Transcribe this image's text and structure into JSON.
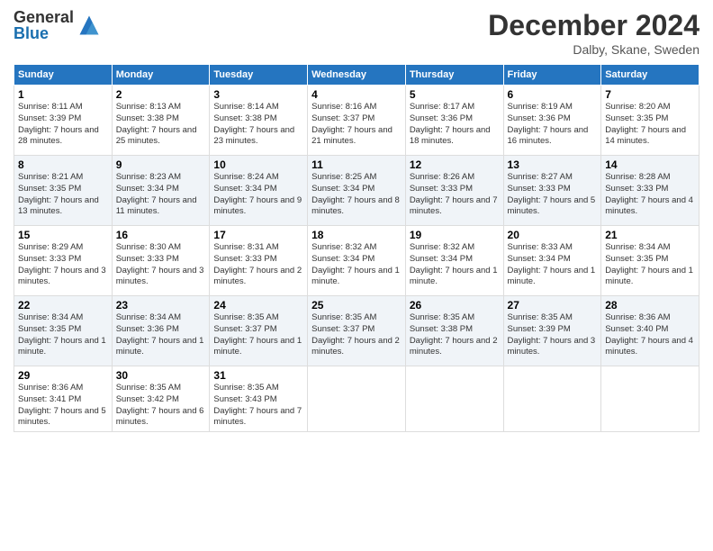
{
  "header": {
    "logo_general": "General",
    "logo_blue": "Blue",
    "month_title": "December 2024",
    "location": "Dalby, Skane, Sweden"
  },
  "days_of_week": [
    "Sunday",
    "Monday",
    "Tuesday",
    "Wednesday",
    "Thursday",
    "Friday",
    "Saturday"
  ],
  "weeks": [
    [
      {
        "day": "1",
        "sunrise": "8:11 AM",
        "sunset": "3:39 PM",
        "daylight": "7 hours and 28 minutes."
      },
      {
        "day": "2",
        "sunrise": "8:13 AM",
        "sunset": "3:38 PM",
        "daylight": "7 hours and 25 minutes."
      },
      {
        "day": "3",
        "sunrise": "8:14 AM",
        "sunset": "3:38 PM",
        "daylight": "7 hours and 23 minutes."
      },
      {
        "day": "4",
        "sunrise": "8:16 AM",
        "sunset": "3:37 PM",
        "daylight": "7 hours and 21 minutes."
      },
      {
        "day": "5",
        "sunrise": "8:17 AM",
        "sunset": "3:36 PM",
        "daylight": "7 hours and 18 minutes."
      },
      {
        "day": "6",
        "sunrise": "8:19 AM",
        "sunset": "3:36 PM",
        "daylight": "7 hours and 16 minutes."
      },
      {
        "day": "7",
        "sunrise": "8:20 AM",
        "sunset": "3:35 PM",
        "daylight": "7 hours and 14 minutes."
      }
    ],
    [
      {
        "day": "8",
        "sunrise": "8:21 AM",
        "sunset": "3:35 PM",
        "daylight": "7 hours and 13 minutes."
      },
      {
        "day": "9",
        "sunrise": "8:23 AM",
        "sunset": "3:34 PM",
        "daylight": "7 hours and 11 minutes."
      },
      {
        "day": "10",
        "sunrise": "8:24 AM",
        "sunset": "3:34 PM",
        "daylight": "7 hours and 9 minutes."
      },
      {
        "day": "11",
        "sunrise": "8:25 AM",
        "sunset": "3:34 PM",
        "daylight": "7 hours and 8 minutes."
      },
      {
        "day": "12",
        "sunrise": "8:26 AM",
        "sunset": "3:33 PM",
        "daylight": "7 hours and 7 minutes."
      },
      {
        "day": "13",
        "sunrise": "8:27 AM",
        "sunset": "3:33 PM",
        "daylight": "7 hours and 5 minutes."
      },
      {
        "day": "14",
        "sunrise": "8:28 AM",
        "sunset": "3:33 PM",
        "daylight": "7 hours and 4 minutes."
      }
    ],
    [
      {
        "day": "15",
        "sunrise": "8:29 AM",
        "sunset": "3:33 PM",
        "daylight": "7 hours and 3 minutes."
      },
      {
        "day": "16",
        "sunrise": "8:30 AM",
        "sunset": "3:33 PM",
        "daylight": "7 hours and 3 minutes."
      },
      {
        "day": "17",
        "sunrise": "8:31 AM",
        "sunset": "3:33 PM",
        "daylight": "7 hours and 2 minutes."
      },
      {
        "day": "18",
        "sunrise": "8:32 AM",
        "sunset": "3:34 PM",
        "daylight": "7 hours and 1 minute."
      },
      {
        "day": "19",
        "sunrise": "8:32 AM",
        "sunset": "3:34 PM",
        "daylight": "7 hours and 1 minute."
      },
      {
        "day": "20",
        "sunrise": "8:33 AM",
        "sunset": "3:34 PM",
        "daylight": "7 hours and 1 minute."
      },
      {
        "day": "21",
        "sunrise": "8:34 AM",
        "sunset": "3:35 PM",
        "daylight": "7 hours and 1 minute."
      }
    ],
    [
      {
        "day": "22",
        "sunrise": "8:34 AM",
        "sunset": "3:35 PM",
        "daylight": "7 hours and 1 minute."
      },
      {
        "day": "23",
        "sunrise": "8:34 AM",
        "sunset": "3:36 PM",
        "daylight": "7 hours and 1 minute."
      },
      {
        "day": "24",
        "sunrise": "8:35 AM",
        "sunset": "3:37 PM",
        "daylight": "7 hours and 1 minute."
      },
      {
        "day": "25",
        "sunrise": "8:35 AM",
        "sunset": "3:37 PM",
        "daylight": "7 hours and 2 minutes."
      },
      {
        "day": "26",
        "sunrise": "8:35 AM",
        "sunset": "3:38 PM",
        "daylight": "7 hours and 2 minutes."
      },
      {
        "day": "27",
        "sunrise": "8:35 AM",
        "sunset": "3:39 PM",
        "daylight": "7 hours and 3 minutes."
      },
      {
        "day": "28",
        "sunrise": "8:36 AM",
        "sunset": "3:40 PM",
        "daylight": "7 hours and 4 minutes."
      }
    ],
    [
      {
        "day": "29",
        "sunrise": "8:36 AM",
        "sunset": "3:41 PM",
        "daylight": "7 hours and 5 minutes."
      },
      {
        "day": "30",
        "sunrise": "8:35 AM",
        "sunset": "3:42 PM",
        "daylight": "7 hours and 6 minutes."
      },
      {
        "day": "31",
        "sunrise": "8:35 AM",
        "sunset": "3:43 PM",
        "daylight": "7 hours and 7 minutes."
      },
      null,
      null,
      null,
      null
    ]
  ],
  "labels": {
    "sunrise": "Sunrise:",
    "sunset": "Sunset:",
    "daylight": "Daylight:"
  }
}
